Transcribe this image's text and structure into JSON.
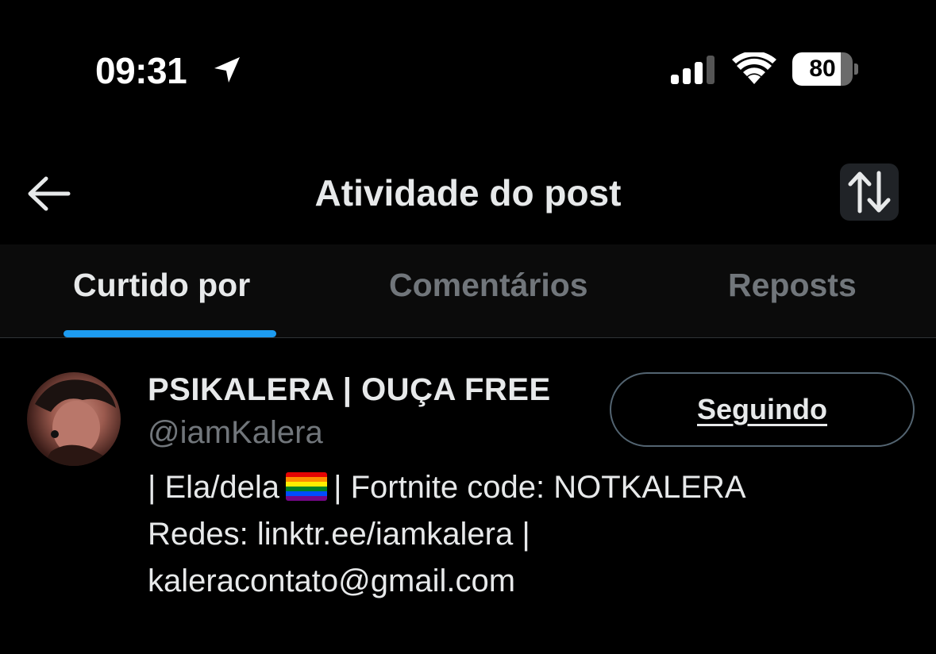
{
  "status_bar": {
    "time": "09:31",
    "location_icon": "location-arrow-icon",
    "signal_icon": "cellular-signal-icon",
    "wifi_icon": "wifi-icon",
    "battery_level": 80,
    "battery_label": "80"
  },
  "header": {
    "back_icon": "arrow-left-icon",
    "title": "Atividade do post",
    "sort_icon": "sort-arrows-icon"
  },
  "tabs": [
    {
      "label": "Curtido por",
      "active": true
    },
    {
      "label": "Comentários",
      "active": false
    },
    {
      "label": "Reposts",
      "active": false
    }
  ],
  "colors": {
    "accent": "#1d9bf0",
    "text_primary": "#e7e9ea",
    "text_secondary": "#71767b",
    "background": "#000000"
  },
  "users": [
    {
      "display_name": "PSIKALERA | OUÇA FREE",
      "handle": "@iamKalera",
      "follow_button_label": "Seguindo",
      "bio": {
        "line1_before_flag": "| Ela/dela",
        "flag_icon": "rainbow-flag-icon",
        "line1_after_flag": "| Fortnite code: NOTKALERA",
        "line2": "Redes: linktr.ee/iamkalera |",
        "line3": "kaleracontato@gmail.com"
      }
    }
  ]
}
